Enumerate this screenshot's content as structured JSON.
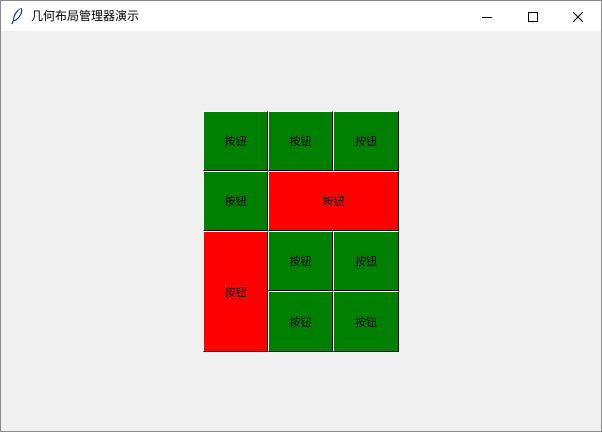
{
  "window": {
    "title": "几何布局管理器演示",
    "icon": "feather-icon",
    "controls": {
      "minimize_icon": "minimize-icon",
      "maximize_icon": "maximize-icon",
      "close_icon": "close-icon"
    }
  },
  "colors": {
    "green": "#008000",
    "red": "#ff0000",
    "background": "#f0f0f0"
  },
  "grid": {
    "buttons": [
      {
        "label": "按钮",
        "color": "green",
        "row": 0,
        "column": 0,
        "rowspan": 1,
        "columnspan": 1
      },
      {
        "label": "按钮",
        "color": "green",
        "row": 0,
        "column": 1,
        "rowspan": 1,
        "columnspan": 1
      },
      {
        "label": "按钮",
        "color": "green",
        "row": 0,
        "column": 2,
        "rowspan": 1,
        "columnspan": 1
      },
      {
        "label": "按钮",
        "color": "green",
        "row": 1,
        "column": 0,
        "rowspan": 1,
        "columnspan": 1
      },
      {
        "label": "按钮",
        "color": "red",
        "row": 1,
        "column": 1,
        "rowspan": 1,
        "columnspan": 2
      },
      {
        "label": "按钮",
        "color": "red",
        "row": 2,
        "column": 0,
        "rowspan": 2,
        "columnspan": 1
      },
      {
        "label": "按钮",
        "color": "green",
        "row": 2,
        "column": 1,
        "rowspan": 1,
        "columnspan": 1
      },
      {
        "label": "按钮",
        "color": "green",
        "row": 2,
        "column": 2,
        "rowspan": 1,
        "columnspan": 1
      },
      {
        "label": "按钮",
        "color": "green",
        "row": 3,
        "column": 1,
        "rowspan": 1,
        "columnspan": 1
      },
      {
        "label": "按钮",
        "color": "green",
        "row": 3,
        "column": 2,
        "rowspan": 1,
        "columnspan": 1
      }
    ]
  }
}
